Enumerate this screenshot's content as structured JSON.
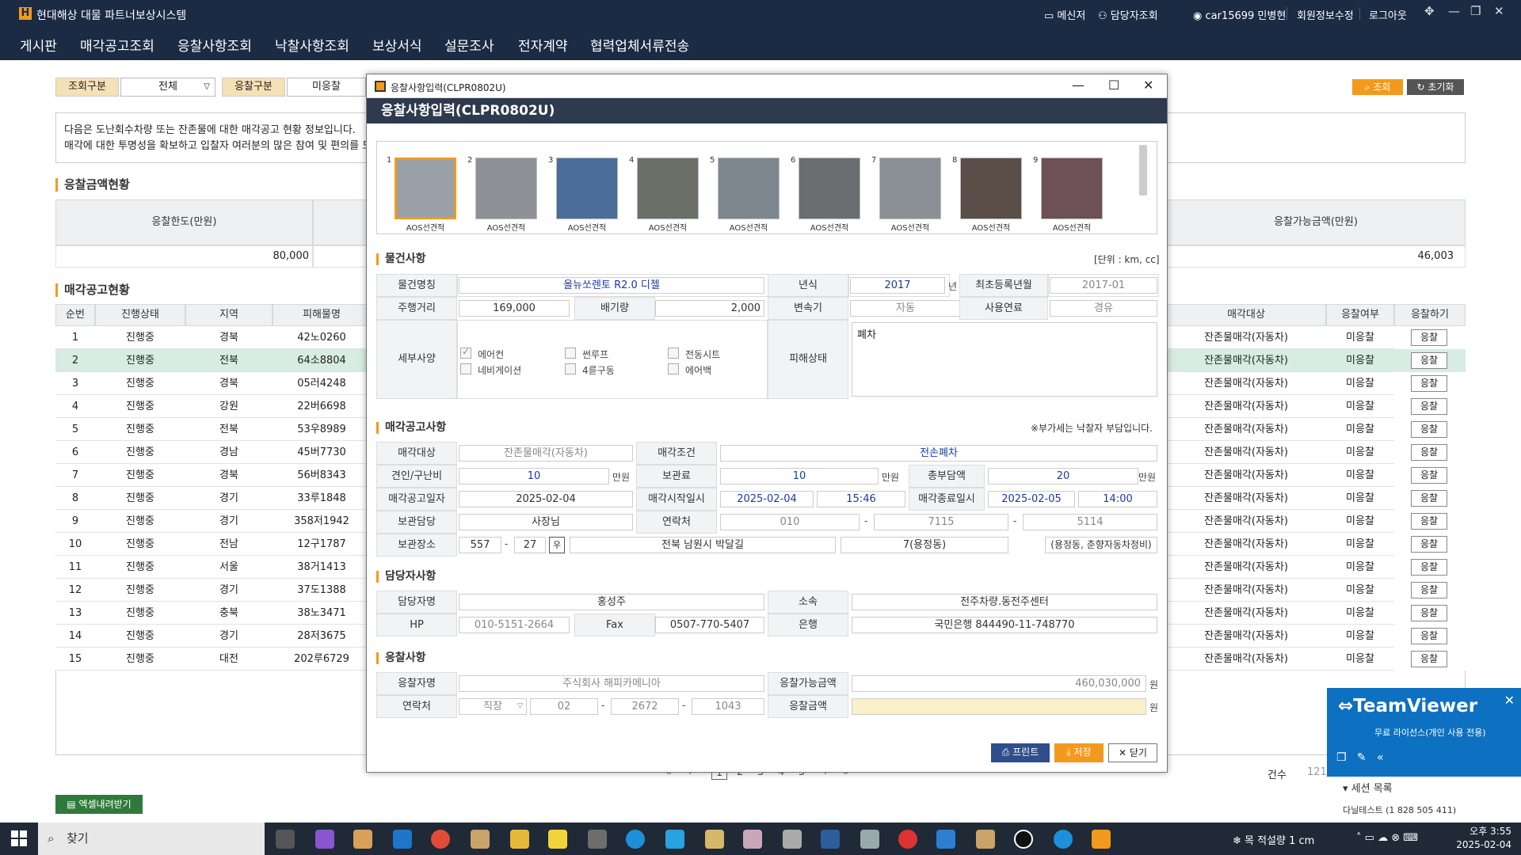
{
  "app": {
    "title": "현대해상 대물 파트너보상시스템",
    "logo": "H",
    "messenger": "메신저",
    "manager_search": "담당자조회",
    "user": "car15699 민병현",
    "edit_profile": "회원정보수정",
    "logout": "로그아웃"
  },
  "menu": [
    "게시판",
    "매각공고조회",
    "응찰사항조회",
    "낙찰사항조회",
    "보상서식",
    "설문조사",
    "전자계약",
    "협력업체서류전송"
  ],
  "search": {
    "label1": "조회구분",
    "value1": "전체",
    "label2": "응찰구분",
    "value2": "미응찰",
    "search_btn": "조회",
    "reset_btn": "초기화"
  },
  "notice": {
    "line1": "다음은 도난회수차량 또는 잔존물에 대한 매각공고 현황 정보입니다.",
    "line2": "매각에 대한 투명성을 확보하고 입찰자 여러분의 많은 참여 및 편의를 도모하"
  },
  "bid_amount": {
    "title": "응찰금액현황",
    "col1": "응찰한도(만원)",
    "val1": "80,000",
    "col2": "응찰가능금액(만원)",
    "val2": "46,003"
  },
  "notice_list": {
    "title": "매각공고현황",
    "headers": [
      "순번",
      "진행상태",
      "지역",
      "피해물명",
      "매각대상",
      "응찰여부",
      "응찰하기"
    ],
    "rows": [
      {
        "no": "1",
        "status": "진행중",
        "region": "경북",
        "plate": "42노0260",
        "target": "잔존물매각(자동차)",
        "bid": "미응찰",
        "btn": "응찰"
      },
      {
        "no": "2",
        "status": "진행중",
        "region": "전북",
        "plate": "64소8804",
        "target": "잔존물매각(자동차)",
        "bid": "미응찰",
        "btn": "응찰"
      },
      {
        "no": "3",
        "status": "진행중",
        "region": "경북",
        "plate": "05러4248",
        "target": "잔존물매각(자동차)",
        "bid": "미응찰",
        "btn": "응찰"
      },
      {
        "no": "4",
        "status": "진행중",
        "region": "강원",
        "plate": "22버6698",
        "target": "잔존물매각(자동차)",
        "bid": "미응찰",
        "btn": "응찰"
      },
      {
        "no": "5",
        "status": "진행중",
        "region": "전북",
        "plate": "53우8989",
        "target": "잔존물매각(자동차)",
        "bid": "미응찰",
        "btn": "응찰"
      },
      {
        "no": "6",
        "status": "진행중",
        "region": "경남",
        "plate": "45버7730",
        "target": "잔존물매각(자동차)",
        "bid": "미응찰",
        "btn": "응찰"
      },
      {
        "no": "7",
        "status": "진행중",
        "region": "경북",
        "plate": "56버8343",
        "target": "잔존물매각(자동차)",
        "bid": "미응찰",
        "btn": "응찰"
      },
      {
        "no": "8",
        "status": "진행중",
        "region": "경기",
        "plate": "33루1848",
        "target": "잔존물매각(자동차)",
        "bid": "미응찰",
        "btn": "응찰"
      },
      {
        "no": "9",
        "status": "진행중",
        "region": "경기",
        "plate": "358저1942",
        "target": "잔존물매각(자동차)",
        "bid": "미응찰",
        "btn": "응찰"
      },
      {
        "no": "10",
        "status": "진행중",
        "region": "전남",
        "plate": "12구1787",
        "target": "잔존물매각(자동차)",
        "bid": "미응찰",
        "btn": "응찰"
      },
      {
        "no": "11",
        "status": "진행중",
        "region": "서울",
        "plate": "38거1413",
        "target": "잔존물매각(자동차)",
        "bid": "미응찰",
        "btn": "응찰"
      },
      {
        "no": "12",
        "status": "진행중",
        "region": "경기",
        "plate": "37도1388",
        "target": "잔존물매각(자동차)",
        "bid": "미응찰",
        "btn": "응찰"
      },
      {
        "no": "13",
        "status": "진행중",
        "region": "충북",
        "plate": "38노3471",
        "target": "잔존물매각(자동차)",
        "bid": "미응찰",
        "btn": "응찰"
      },
      {
        "no": "14",
        "status": "진행중",
        "region": "경기",
        "plate": "28저3675",
        "target": "잔존물매각(자동차)",
        "bid": "미응찰",
        "btn": "응찰"
      },
      {
        "no": "15",
        "status": "진행중",
        "region": "대전",
        "plate": "202루6729",
        "target": "잔존물매각(자동차)",
        "bid": "미응찰",
        "btn": "응찰"
      }
    ]
  },
  "excel_btn": "엑셀내려받기",
  "pager": {
    "pages": [
      "1",
      "2",
      "3",
      "4",
      "5"
    ],
    "count_label": "건수",
    "count": "121"
  },
  "modal": {
    "window_title": "응찰사항입력(CLPR0802U)",
    "header": "응찰사항입력(CLPR0802U)",
    "thumb_caption": "AOS선견적",
    "thumb_nums": [
      "1",
      "2",
      "3",
      "4",
      "5",
      "6",
      "7",
      "8",
      "9"
    ],
    "item": {
      "title": "물건사항",
      "unit": "[단위 : km, cc]",
      "name_label": "물건명칭",
      "name": "올뉴쏘렌토 R2.0 디젤",
      "year_label": "년식",
      "year": "2017",
      "year_suffix": "년",
      "reg_label": "최초등록년월",
      "reg": "2017-01",
      "mileage_label": "주행거리",
      "mileage": "169,000",
      "cc_label": "배기량",
      "cc": "2,000",
      "trans_label": "변속기",
      "trans": "자동",
      "fuel_label": "사용연료",
      "fuel": "경유",
      "options_label": "세부사양",
      "options": [
        "에어컨",
        "썬루프",
        "전동시트",
        "네비게이션",
        "4륜구동",
        "에어백"
      ],
      "damage_label": "피해상태",
      "damage": "폐차"
    },
    "sale": {
      "title": "매각공고사항",
      "vat_note": "※부가세는 낙찰자 부담입니다.",
      "target_label": "매각대상",
      "target": "잔존물매각(자동차)",
      "cond_label": "매각조건",
      "cond": "전손폐차",
      "tow_label": "견인/구난비",
      "tow": "10",
      "unit": "만원",
      "storage_fee_label": "보관료",
      "storage_fee": "10",
      "total_label": "총부담액",
      "total": "20",
      "notice_date_label": "매각공고일자",
      "notice_date": "2025-02-04",
      "start_label": "매각시작일시",
      "start_date": "2025-02-04",
      "start_time": "15:46",
      "end_label": "매각종료일시",
      "end_date": "2025-02-05",
      "end_time": "14:00",
      "keeper_label": "보관담당",
      "keeper": "사장님",
      "contact_label": "연락처",
      "phone1": "010",
      "phone2": "7115",
      "phone3": "5114",
      "place_label": "보관장소",
      "zip1": "557",
      "zip2": "27",
      "zip_btn": "우",
      "addr1": "전북 남원시 박달길",
      "addr2": "7(용정동)",
      "addr3": "(용정동, 춘향자동차정비)"
    },
    "manager": {
      "title": "담당자사항",
      "name_label": "담당자명",
      "name": "홍성주",
      "dept_label": "소속",
      "dept": "전주차량.동전주센터",
      "hp_label": "HP",
      "hp": "010-5151-2664",
      "fax_label": "Fax",
      "fax": "0507-770-5407",
      "bank_label": "은행",
      "bank": "국민은행 844490-11-748770"
    },
    "bid": {
      "title": "응찰사항",
      "bidder_label": "응찰자명",
      "bidder": "주식회사 해피카메니아",
      "avail_label": "응찰가능금액",
      "avail": "460,030,000",
      "won": "원",
      "contact_label": "연락처",
      "phone_type": "직장",
      "p1": "02",
      "p2": "2672",
      "p3": "1043",
      "amount_label": "응찰금액",
      "amount": ""
    },
    "buttons": {
      "print": "프린트",
      "save": "저장",
      "close": "닫기"
    }
  },
  "teamviewer": {
    "title": "TeamViewer",
    "sub": "무료 라이선스(개인 사용 전용)",
    "session": "세션 목록",
    "item": "다닐테스트 (1 828 505 411)"
  },
  "taskbar": {
    "search": "찾기",
    "weather": "목 적설량 1 cm",
    "time": "오후 3:55",
    "date": "2025-02-04"
  }
}
